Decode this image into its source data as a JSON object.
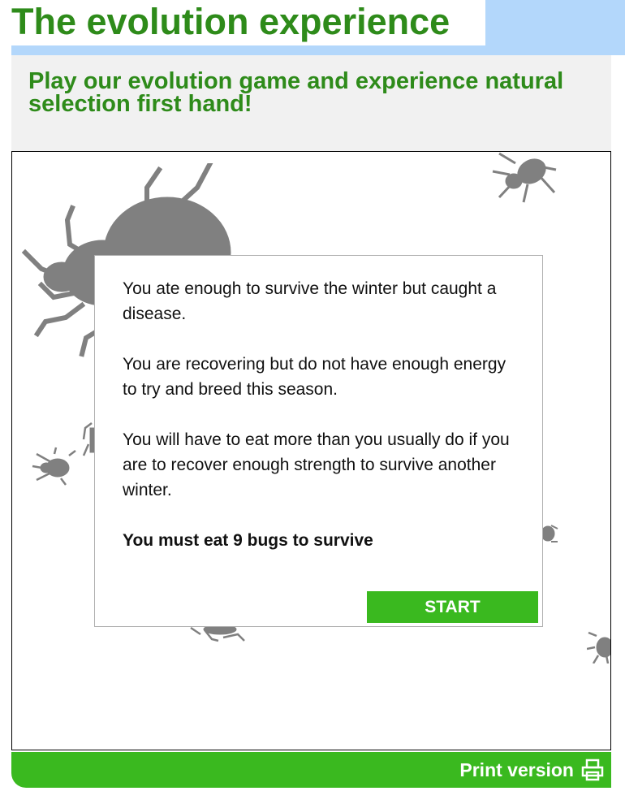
{
  "header": {
    "title": "The evolution experience",
    "subtitle": "Play our evolution game and experience natural selection first hand!"
  },
  "dialog": {
    "paragraphs": [
      "You ate enough to survive the winter but caught a disease.",
      "You are recovering but do not have enough energy to try and breed this season.",
      "You will have to eat more than you usually do if you are to recover enough strength to survive another winter."
    ],
    "goal": "You must eat 9 bugs to survive",
    "start_label": "START"
  },
  "footer": {
    "print_label": "Print version",
    "print_icon": "printer-icon"
  },
  "colors": {
    "title_green": "#2e8b1a",
    "button_green": "#3ab91f",
    "header_blue": "#b3d7fb",
    "panel_grey": "#f1f1f1",
    "bug_grey": "#808080"
  }
}
